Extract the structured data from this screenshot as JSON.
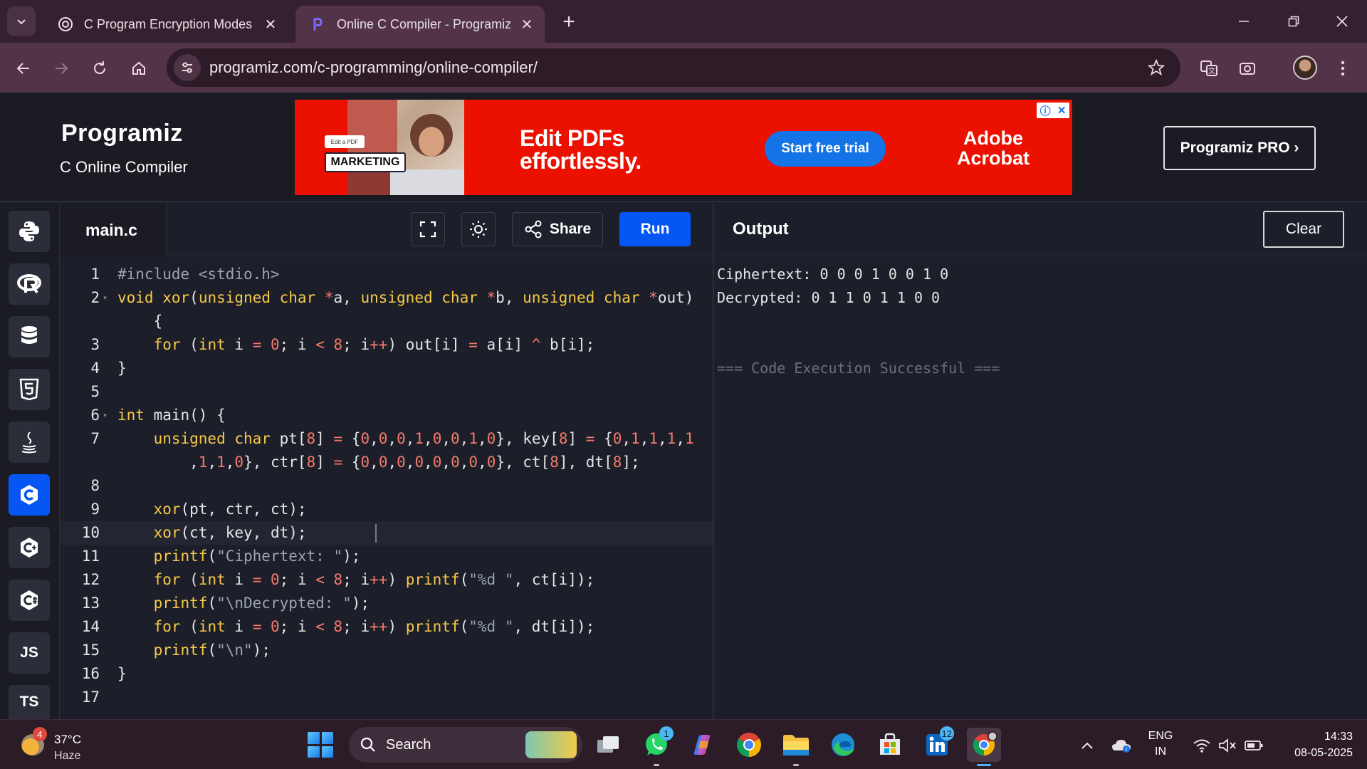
{
  "browser": {
    "tabs": [
      {
        "title": "C Program Encryption Modes",
        "active": false
      },
      {
        "title": "Online C Compiler - Programiz",
        "active": true
      }
    ],
    "url": "programiz.com/c-programming/online-compiler/"
  },
  "site": {
    "logo": "Programiz",
    "subtitle": "C Online Compiler",
    "pro_button": "Programiz PRO ›"
  },
  "ad": {
    "tag": "MARKETING",
    "mini": "Edit a PDF",
    "headline_1": "Edit PDFs",
    "headline_2": "effortlessly.",
    "cta": "Start free trial",
    "brand_1": "Adobe",
    "brand_2": "Acrobat"
  },
  "sidebar": {
    "languages": [
      {
        "name": "python",
        "label": ""
      },
      {
        "name": "r",
        "label": ""
      },
      {
        "name": "sql",
        "label": ""
      },
      {
        "name": "html",
        "label": ""
      },
      {
        "name": "java",
        "label": ""
      },
      {
        "name": "c",
        "label": "",
        "active": true
      },
      {
        "name": "cpp",
        "label": ""
      },
      {
        "name": "csharp",
        "label": ""
      },
      {
        "name": "js",
        "label": "JS"
      },
      {
        "name": "ts",
        "label": "TS"
      }
    ]
  },
  "editor": {
    "filename": "main.c",
    "share_label": "Share",
    "run_label": "Run",
    "lines": [
      {
        "n": "1",
        "fold": false,
        "html": "<span class=\"pp\">#include &lt;stdio.h&gt;</span>"
      },
      {
        "n": "2",
        "fold": true,
        "html": "<span class=\"kw\">void</span> <span class=\"kw\">xor</span>(<span class=\"kw\">unsigned</span> <span class=\"kw\">char</span> <span class=\"op\">*</span>a, <span class=\"kw\">unsigned</span> <span class=\"kw\">char</span> <span class=\"op\">*</span>b, <span class=\"kw\">unsigned</span> <span class=\"kw\">char</span> <span class=\"op\">*</span>out)"
      },
      {
        "n": "",
        "fold": false,
        "html": "    {"
      },
      {
        "n": "3",
        "fold": false,
        "html": "    <span class=\"kw\">for</span> (<span class=\"kw\">int</span> i <span class=\"op\">=</span> <span class=\"num\">0</span>; i <span class=\"op\">&lt;</span> <span class=\"num\">8</span>; i<span class=\"op\">++</span>) out[i] <span class=\"op\">=</span> a[i] <span class=\"op\">^</span> b[i];"
      },
      {
        "n": "4",
        "fold": false,
        "html": "}"
      },
      {
        "n": "5",
        "fold": false,
        "html": ""
      },
      {
        "n": "6",
        "fold": true,
        "html": "<span class=\"kw\">int</span> main() {"
      },
      {
        "n": "7",
        "fold": false,
        "html": "    <span class=\"kw\">unsigned</span> <span class=\"kw\">char</span> pt[<span class=\"num\">8</span>] <span class=\"op\">=</span> {<span class=\"num\">0</span>,<span class=\"num\">0</span>,<span class=\"num\">0</span>,<span class=\"num\">1</span>,<span class=\"num\">0</span>,<span class=\"num\">0</span>,<span class=\"num\">1</span>,<span class=\"num\">0</span>}, key[<span class=\"num\">8</span>] <span class=\"op\">=</span> {<span class=\"num\">0</span>,<span class=\"num\">1</span>,<span class=\"num\">1</span>,<span class=\"num\">1</span>,<span class=\"num\">1</span>"
      },
      {
        "n": "",
        "fold": false,
        "html": "        ,<span class=\"num\">1</span>,<span class=\"num\">1</span>,<span class=\"num\">0</span>}, ctr[<span class=\"num\">8</span>] <span class=\"op\">=</span> {<span class=\"num\">0</span>,<span class=\"num\">0</span>,<span class=\"num\">0</span>,<span class=\"num\">0</span>,<span class=\"num\">0</span>,<span class=\"num\">0</span>,<span class=\"num\">0</span>,<span class=\"num\">0</span>}, ct[<span class=\"num\">8</span>], dt[<span class=\"num\">8</span>];"
      },
      {
        "n": "8",
        "fold": false,
        "html": ""
      },
      {
        "n": "9",
        "fold": false,
        "html": "    <span class=\"kw\">xor</span>(pt, ctr, ct);"
      },
      {
        "n": "10",
        "fold": false,
        "current": true,
        "html": "    <span class=\"kw\">xor</span>(ct, key, dt);"
      },
      {
        "n": "11",
        "fold": false,
        "html": "    <span class=\"kw\">printf</span>(<span class=\"str\">\"Ciphertext: \"</span>);"
      },
      {
        "n": "12",
        "fold": false,
        "html": "    <span class=\"kw\">for</span> (<span class=\"kw\">int</span> i <span class=\"op\">=</span> <span class=\"num\">0</span>; i <span class=\"op\">&lt;</span> <span class=\"num\">8</span>; i<span class=\"op\">++</span>) <span class=\"kw\">printf</span>(<span class=\"str\">\"%d \"</span>, ct[i]);"
      },
      {
        "n": "13",
        "fold": false,
        "html": "    <span class=\"kw\">printf</span>(<span class=\"str\">\"\\nDecrypted: \"</span>);"
      },
      {
        "n": "14",
        "fold": false,
        "html": "    <span class=\"kw\">for</span> (<span class=\"kw\">int</span> i <span class=\"op\">=</span> <span class=\"num\">0</span>; i <span class=\"op\">&lt;</span> <span class=\"num\">8</span>; i<span class=\"op\">++</span>) <span class=\"kw\">printf</span>(<span class=\"str\">\"%d \"</span>, dt[i]);"
      },
      {
        "n": "15",
        "fold": false,
        "html": "    <span class=\"kw\">printf</span>(<span class=\"str\">\"\\n\"</span>);"
      },
      {
        "n": "16",
        "fold": false,
        "html": "}"
      },
      {
        "n": "17",
        "fold": false,
        "html": ""
      }
    ]
  },
  "output": {
    "title": "Output",
    "clear_label": "Clear",
    "lines": [
      {
        "text": "Ciphertext: 0 0 0 1 0 0 1 0",
        "muted": false
      },
      {
        "text": "Decrypted: 0 1 1 0 1 1 0 0",
        "muted": false
      },
      {
        "text": "",
        "muted": false
      },
      {
        "text": "",
        "muted": false
      },
      {
        "text": "=== Code Execution Successful ===",
        "muted": true
      }
    ]
  },
  "taskbar": {
    "weather_temp": "37°C",
    "weather_cond": "Haze",
    "weather_badge": "4",
    "search_placeholder": "Search",
    "whatsapp_badge": "1",
    "linkedin_badge": "12",
    "lang_1": "ENG",
    "lang_2": "IN",
    "time": "14:33",
    "date": "08-05-2025"
  },
  "colors": {
    "accent": "#0556f3",
    "ad_red": "#eb1000",
    "chrome_tab": "#523347"
  }
}
